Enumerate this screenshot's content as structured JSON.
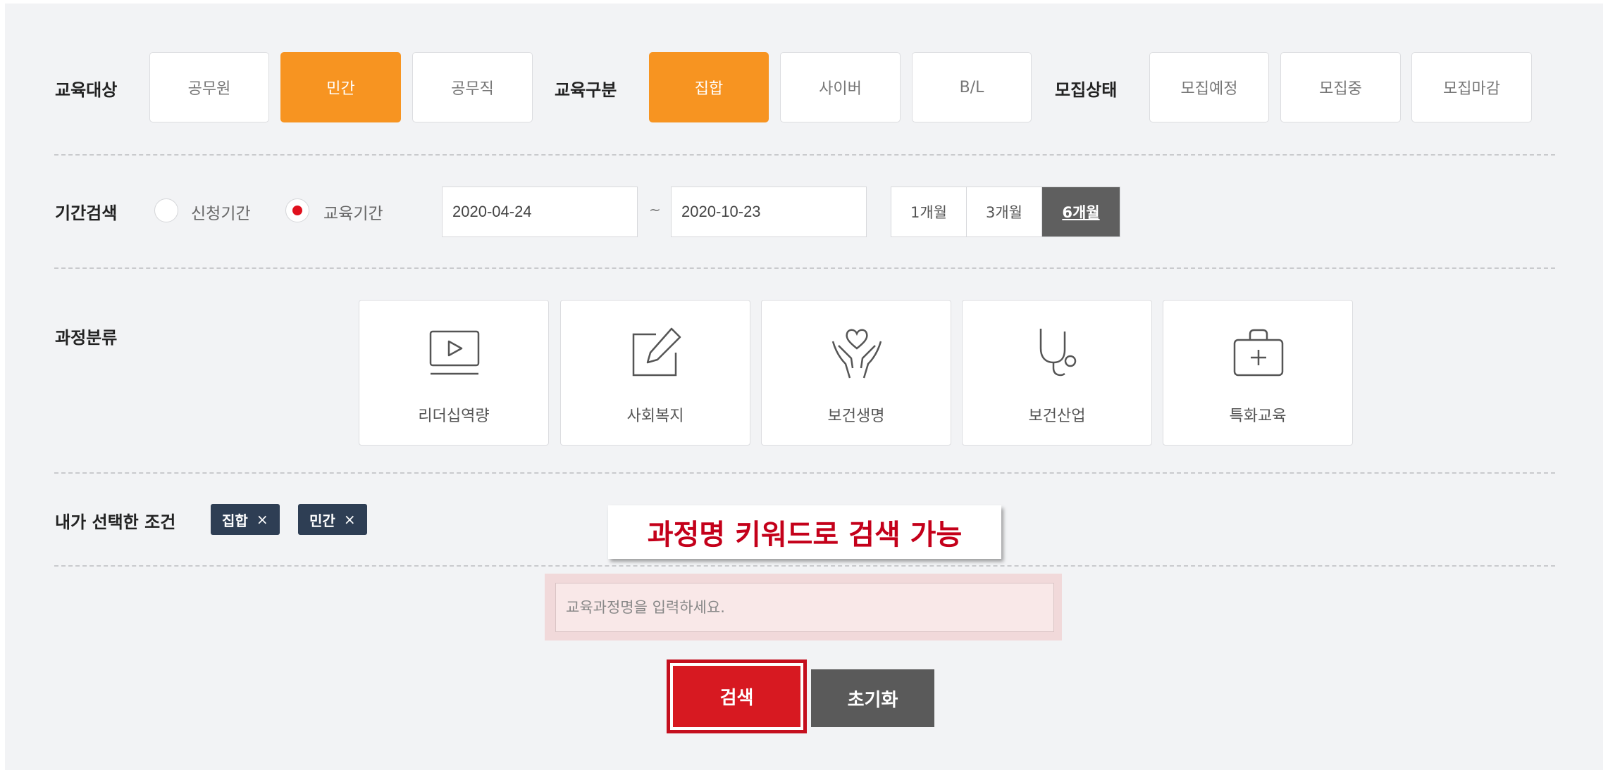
{
  "filters": {
    "target": {
      "label": "교육대상",
      "options": [
        "공무원",
        "민간",
        "공무직"
      ],
      "selected": "민간"
    },
    "type": {
      "label": "교육구분",
      "options": [
        "집합",
        "사이버",
        "B/L"
      ],
      "selected": "집합"
    },
    "status": {
      "label": "모집상태",
      "options": [
        "모집예정",
        "모집중",
        "모집마감"
      ]
    }
  },
  "period": {
    "label": "기간검색",
    "radio_apply": "신청기간",
    "radio_edu": "교육기간",
    "selected_radio": "교육기간",
    "start_date": "2020-04-24",
    "tilde": "~",
    "end_date": "2020-10-23",
    "ranges": [
      "1개월",
      "3개월",
      "6개월"
    ],
    "selected_range": "6개월"
  },
  "category": {
    "label": "과정분류",
    "items": [
      {
        "label": "리더십역량",
        "icon": "video-play-icon"
      },
      {
        "label": "사회복지",
        "icon": "edit-pencil-icon"
      },
      {
        "label": "보건생명",
        "icon": "hands-heart-icon"
      },
      {
        "label": "보건산업",
        "icon": "stethoscope-icon"
      },
      {
        "label": "특화교육",
        "icon": "first-aid-kit-icon"
      }
    ]
  },
  "selected_conditions": {
    "label": "내가 선택한 조건",
    "chips": [
      "집합",
      "민간"
    ],
    "remove_glyph": "×"
  },
  "callout": "과정명 키워드로 검색 가능",
  "search": {
    "placeholder": "교육과정명을 입력하세요.",
    "search_label": "검색",
    "reset_label": "초기화"
  },
  "colors": {
    "accent_orange": "#f79421",
    "highlight_red": "#c50f1e",
    "chip_navy": "#2e3e54",
    "radio_red": "#e0101d"
  }
}
